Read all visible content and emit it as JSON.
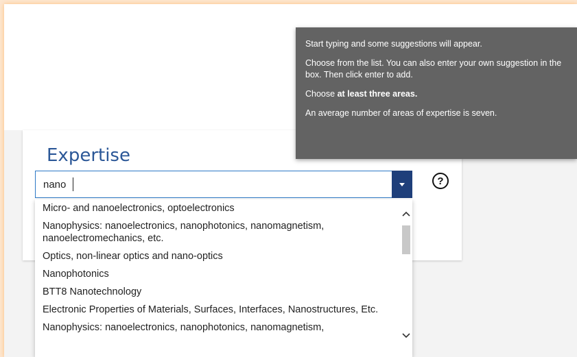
{
  "expertise": {
    "title": "Expertise",
    "input_value": "nano",
    "suggestions": [
      "Micro- and nanoelectronics, optoelectronics",
      "Nanophysics: nanoelectronics, nanophotonics, nanomagnetism, nanoelectromechanics, etc.",
      "Optics, non-linear optics and nano-optics",
      "Nanophotonics",
      "BTT8 Nanotechnology",
      "Electronic Properties of Materials, Surfaces, Interfaces, Nanostructures, Etc.",
      "Nanophysics: nanoelectronics, nanophotonics, nanomagnetism,"
    ]
  },
  "help": {
    "icon_glyph": "?",
    "tooltip": {
      "line1": "Start typing and some suggestions will appear.",
      "line2": "Choose from the list. You can also enter your own suggestion in the box. Then click enter to add.",
      "line3_prefix": "Choose ",
      "line3_bold": "at least three areas.",
      "line4": "An average number of areas of expertise is seven."
    }
  },
  "icons": {
    "dropdown": "chevron-down-icon",
    "help": "question-circle-icon",
    "scroll_up": "chevron-up-icon",
    "scroll_down": "chevron-down-icon"
  },
  "colors": {
    "accent": "#2b5797",
    "dropdown_button": "#1f3f7a",
    "tooltip_bg": "#636363"
  }
}
